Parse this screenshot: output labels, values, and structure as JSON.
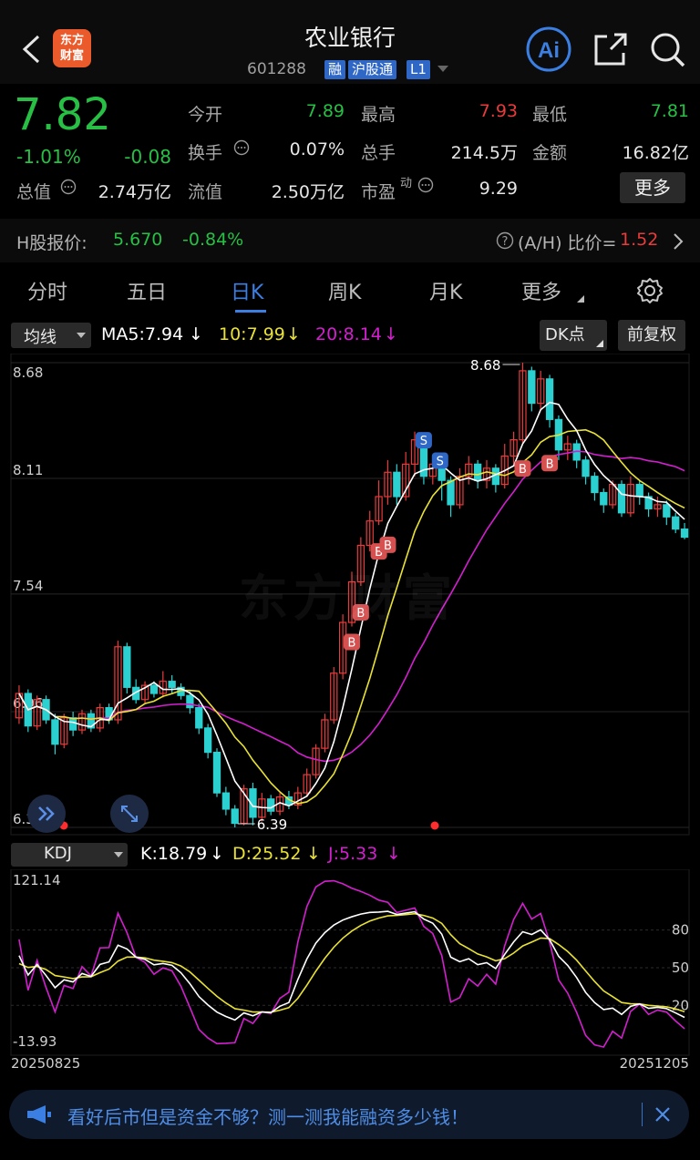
{
  "header": {
    "title": "农业银行",
    "code": "601288",
    "tags": [
      "融",
      "沪股通",
      "L1"
    ],
    "logo_text": "东方财富"
  },
  "quote": {
    "price": "7.82",
    "change_pct": "-1.01%",
    "change": "-0.08",
    "labels": {
      "open": "今开",
      "high": "最高",
      "low": "最低",
      "turnover": "换手",
      "volume": "总手",
      "amount": "金额",
      "mktcap": "总值",
      "float": "流值",
      "pe": "市盈"
    },
    "values": {
      "open": "7.89",
      "high": "7.93",
      "low": "7.81",
      "turnover": "0.07%",
      "volume": "214.5万",
      "amount": "16.82亿",
      "mktcap": "2.74万亿",
      "float": "2.50万亿",
      "pe": "9.29"
    },
    "pe_sup": "动",
    "more_label": "更多",
    "h_share_label": "H股报价:",
    "h_share_price": "5.670",
    "h_share_change": "-0.84%",
    "ah_label": "(A/H) 比价=",
    "ah_value": "1.52"
  },
  "tabs": [
    "分时",
    "五日",
    "日K",
    "周K",
    "月K",
    "更多"
  ],
  "active_tab": "日K",
  "chart_bar": {
    "indicator": "均线",
    "ma5": "MA5:7.94",
    "ma10": "10:7.99",
    "ma20": "20:8.14",
    "dk_label": "DK点",
    "adjust_label": "前复权",
    "watermark": "东方财富"
  },
  "kdj_bar": {
    "indicator": "KDJ",
    "k": "K:18.79",
    "d": "D:25.52",
    "j": "J:5.33"
  },
  "colors": {
    "up": "#e83b3b",
    "down": "#2bd1d1",
    "ma5": "#ffffff",
    "ma10": "#e9e234",
    "ma20": "#d41fd0",
    "accent": "#3b7fe3"
  },
  "chart_data": [
    {
      "type": "candlestick",
      "ylim": [
        6.39,
        8.68
      ],
      "y_ticks": [
        8.68,
        8.11,
        7.54,
        6.96,
        6.39
      ],
      "high_marker": "8.68",
      "low_marker": "6.39",
      "candles": [
        [
          6.93,
          7.05,
          7.09,
          6.9
        ],
        [
          7.05,
          6.89,
          7.07,
          6.86
        ],
        [
          6.89,
          7.02,
          7.04,
          6.87
        ],
        [
          7.02,
          6.92,
          7.04,
          6.9
        ],
        [
          6.92,
          6.8,
          6.95,
          6.75
        ],
        [
          6.8,
          6.93,
          6.95,
          6.78
        ],
        [
          6.93,
          6.87,
          6.96,
          6.84
        ],
        [
          6.87,
          6.95,
          6.97,
          6.85
        ],
        [
          6.95,
          6.88,
          6.97,
          6.86
        ],
        [
          6.88,
          6.98,
          7.0,
          6.86
        ],
        [
          6.98,
          6.92,
          7.0,
          6.9
        ],
        [
          6.92,
          7.28,
          7.31,
          6.9
        ],
        [
          7.28,
          7.08,
          7.3,
          7.05
        ],
        [
          7.08,
          7.02,
          7.12,
          7.0
        ],
        [
          7.02,
          7.09,
          7.11,
          7.0
        ],
        [
          7.09,
          7.05,
          7.11,
          7.03
        ],
        [
          7.05,
          7.11,
          7.16,
          7.03
        ],
        [
          7.11,
          7.08,
          7.14,
          7.05
        ],
        [
          7.08,
          7.04,
          7.1,
          7.02
        ],
        [
          7.04,
          6.98,
          7.06,
          6.95
        ],
        [
          6.98,
          6.88,
          7.0,
          6.85
        ],
        [
          6.88,
          6.76,
          6.9,
          6.73
        ],
        [
          6.76,
          6.56,
          6.78,
          6.54
        ],
        [
          6.56,
          6.48,
          6.59,
          6.45
        ],
        [
          6.48,
          6.41,
          6.5,
          6.39
        ],
        [
          6.41,
          6.58,
          6.6,
          6.4
        ],
        [
          6.58,
          6.44,
          6.61,
          6.4
        ],
        [
          6.44,
          6.53,
          6.56,
          6.42
        ],
        [
          6.53,
          6.47,
          6.55,
          6.45
        ],
        [
          6.47,
          6.54,
          6.56,
          6.45
        ],
        [
          6.54,
          6.5,
          6.57,
          6.48
        ],
        [
          6.5,
          6.56,
          6.59,
          6.48
        ],
        [
          6.56,
          6.65,
          6.68,
          6.54
        ],
        [
          6.65,
          6.78,
          6.8,
          6.63
        ],
        [
          6.78,
          6.92,
          6.95,
          6.76
        ],
        [
          6.92,
          7.15,
          7.18,
          6.9
        ],
        [
          7.15,
          7.4,
          7.44,
          7.12
        ],
        [
          7.4,
          7.6,
          7.65,
          7.38
        ],
        [
          7.6,
          7.78,
          7.82,
          7.58
        ],
        [
          7.78,
          7.9,
          7.95,
          7.75
        ],
        [
          7.9,
          8.02,
          8.1,
          7.88
        ],
        [
          8.02,
          8.14,
          8.2,
          7.98
        ],
        [
          8.14,
          8.02,
          8.18,
          7.98
        ],
        [
          8.02,
          8.18,
          8.24,
          8.0
        ],
        [
          8.18,
          8.3,
          8.34,
          8.12
        ],
        [
          8.3,
          8.12,
          8.32,
          8.08
        ],
        [
          8.12,
          8.18,
          8.22,
          8.08
        ],
        [
          8.18,
          8.1,
          8.2,
          8.0
        ],
        [
          8.1,
          7.98,
          8.12,
          7.92
        ],
        [
          7.98,
          8.12,
          8.16,
          7.96
        ],
        [
          8.12,
          8.18,
          8.22,
          8.08
        ],
        [
          8.18,
          8.1,
          8.2,
          8.06
        ],
        [
          8.1,
          8.16,
          8.2,
          8.06
        ],
        [
          8.16,
          8.08,
          8.18,
          8.04
        ],
        [
          8.08,
          8.22,
          8.28,
          8.06
        ],
        [
          8.22,
          8.3,
          8.34,
          8.18
        ],
        [
          8.3,
          8.64,
          8.68,
          8.28
        ],
        [
          8.64,
          8.48,
          8.66,
          8.44
        ],
        [
          8.48,
          8.6,
          8.64,
          8.45
        ],
        [
          8.6,
          8.4,
          8.62,
          8.36
        ],
        [
          8.4,
          8.25,
          8.42,
          8.2
        ],
        [
          8.25,
          8.28,
          8.32,
          8.2
        ],
        [
          8.28,
          8.2,
          8.3,
          8.16
        ],
        [
          8.2,
          8.12,
          8.22,
          8.08
        ],
        [
          8.12,
          8.04,
          8.14,
          8.0
        ],
        [
          8.04,
          7.98,
          8.06,
          7.94
        ],
        [
          7.98,
          8.08,
          8.1,
          7.96
        ],
        [
          8.08,
          7.94,
          8.1,
          7.92
        ],
        [
          7.94,
          8.08,
          8.12,
          7.92
        ],
        [
          8.08,
          8.02,
          8.1,
          7.98
        ],
        [
          8.02,
          7.96,
          8.04,
          7.92
        ],
        [
          7.96,
          7.98,
          8.02,
          7.92
        ],
        [
          7.98,
          7.92,
          8.0,
          7.88
        ],
        [
          7.92,
          7.86,
          7.94,
          7.84
        ],
        [
          7.86,
          7.82,
          7.89,
          7.81
        ]
      ]
    },
    {
      "type": "line",
      "ylim": [
        -13.93,
        121.14
      ],
      "y_ticks": [
        "121.14",
        "80",
        "50",
        "20",
        "-13.93"
      ],
      "x_start": "20250825",
      "x_end": "20251205",
      "series_colors": [
        "#ffffff",
        "#e9e234",
        "#d41fd0"
      ]
    }
  ],
  "banner": {
    "text": "看好后市但是资金不够？测一测我能融资多少钱！"
  }
}
